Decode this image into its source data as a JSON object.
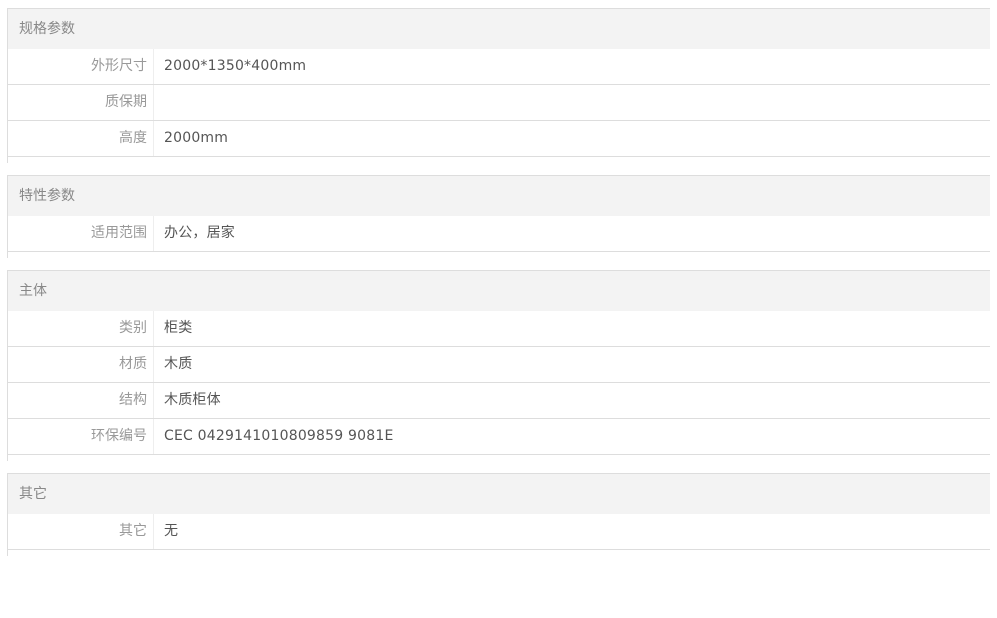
{
  "groups": [
    {
      "title": "规格参数",
      "rows": [
        {
          "label": "外形尺寸",
          "value": "2000*1350*400mm"
        },
        {
          "label": "质保期",
          "value": ""
        },
        {
          "label": "高度",
          "value": "2000mm"
        }
      ]
    },
    {
      "title": "特性参数",
      "rows": [
        {
          "label": "适用范围",
          "value": "办公，居家"
        }
      ]
    },
    {
      "title": "主体",
      "rows": [
        {
          "label": "类别",
          "value": "柜类"
        },
        {
          "label": "材质",
          "value": "木质"
        },
        {
          "label": "结构",
          "value": "木质柜体"
        },
        {
          "label": "环保编号",
          "value": "CEC 0429141010809859 9081E"
        }
      ]
    },
    {
      "title": "其它",
      "rows": [
        {
          "label": "其它",
          "value": "无"
        }
      ]
    }
  ]
}
